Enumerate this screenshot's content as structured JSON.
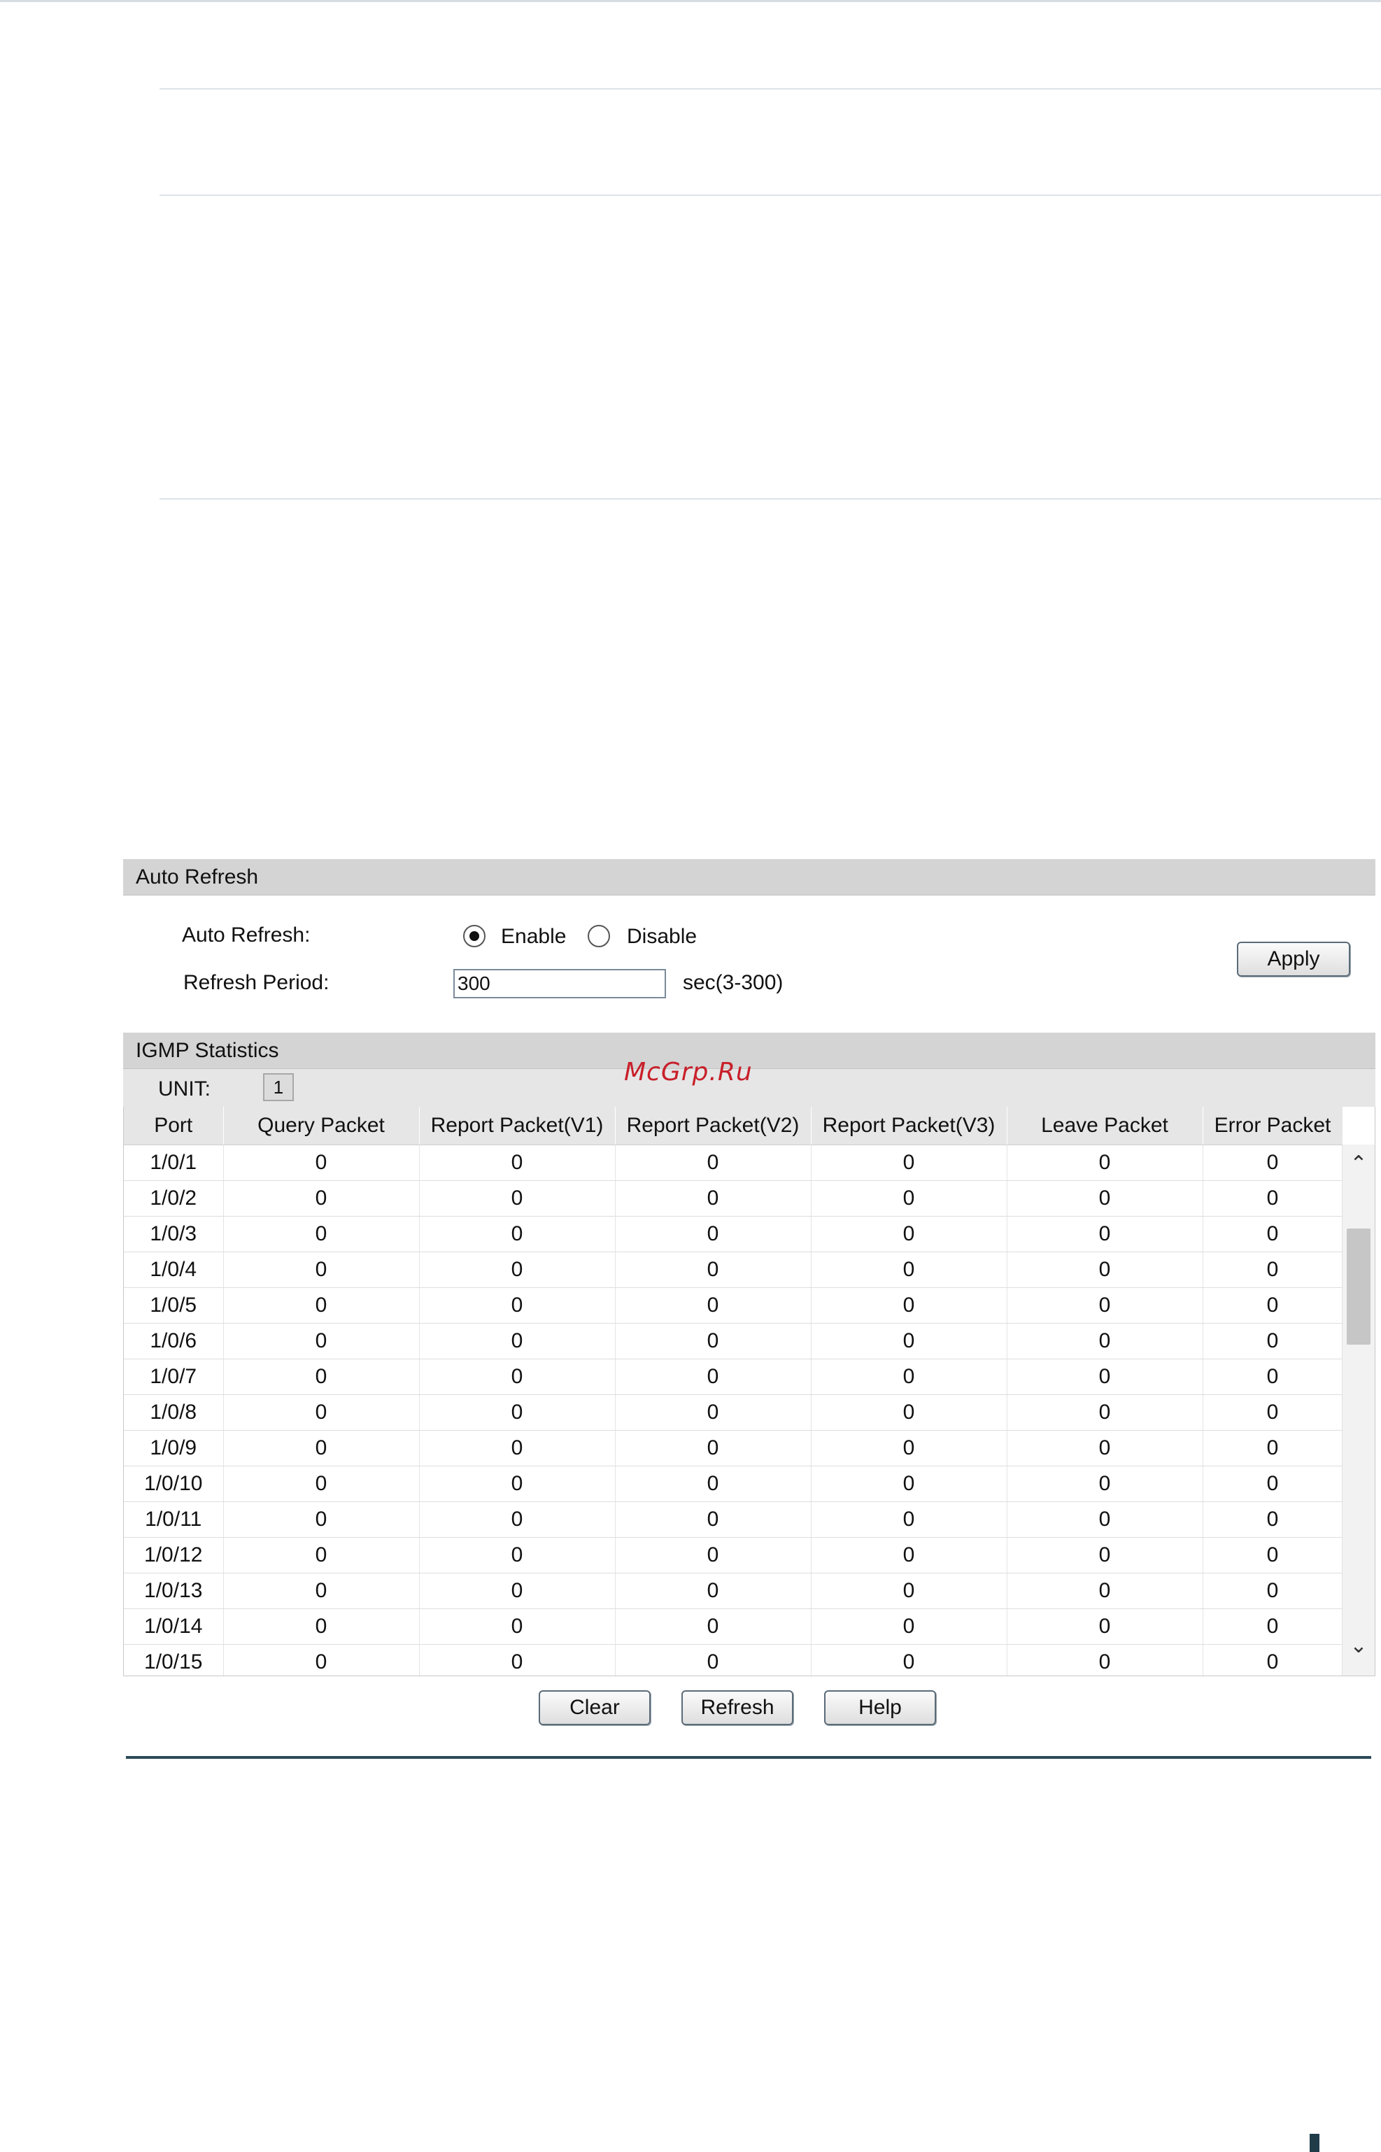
{
  "watermark": "McGrp.Ru",
  "auto_refresh": {
    "section_title": "Auto Refresh",
    "auto_refresh_label": "Auto Refresh:",
    "enable_label": "Enable",
    "disable_label": "Disable",
    "selected": "Enable",
    "refresh_period_label": "Refresh Period:",
    "refresh_period_value": "300",
    "refresh_period_hint": "sec(3-300)",
    "apply_label": "Apply"
  },
  "igmp_statistics": {
    "section_title": "IGMP Statistics",
    "unit_label": "UNIT:",
    "unit_value": "1",
    "columns": [
      "Port",
      "Query Packet",
      "Report Packet(V1)",
      "Report Packet(V2)",
      "Report Packet(V3)",
      "Leave Packet",
      "Error Packet"
    ],
    "rows": [
      [
        "1/0/1",
        "0",
        "0",
        "0",
        "0",
        "0",
        "0"
      ],
      [
        "1/0/2",
        "0",
        "0",
        "0",
        "0",
        "0",
        "0"
      ],
      [
        "1/0/3",
        "0",
        "0",
        "0",
        "0",
        "0",
        "0"
      ],
      [
        "1/0/4",
        "0",
        "0",
        "0",
        "0",
        "0",
        "0"
      ],
      [
        "1/0/5",
        "0",
        "0",
        "0",
        "0",
        "0",
        "0"
      ],
      [
        "1/0/6",
        "0",
        "0",
        "0",
        "0",
        "0",
        "0"
      ],
      [
        "1/0/7",
        "0",
        "0",
        "0",
        "0",
        "0",
        "0"
      ],
      [
        "1/0/8",
        "0",
        "0",
        "0",
        "0",
        "0",
        "0"
      ],
      [
        "1/0/9",
        "0",
        "0",
        "0",
        "0",
        "0",
        "0"
      ],
      [
        "1/0/10",
        "0",
        "0",
        "0",
        "0",
        "0",
        "0"
      ],
      [
        "1/0/11",
        "0",
        "0",
        "0",
        "0",
        "0",
        "0"
      ],
      [
        "1/0/12",
        "0",
        "0",
        "0",
        "0",
        "0",
        "0"
      ],
      [
        "1/0/13",
        "0",
        "0",
        "0",
        "0",
        "0",
        "0"
      ],
      [
        "1/0/14",
        "0",
        "0",
        "0",
        "0",
        "0",
        "0"
      ],
      [
        "1/0/15",
        "0",
        "0",
        "0",
        "0",
        "0",
        "0"
      ]
    ],
    "buttons": {
      "clear": "Clear",
      "refresh": "Refresh",
      "help": "Help"
    },
    "scroll": {
      "up_icon": "chevron-up-icon",
      "down_icon": "chevron-down-icon"
    }
  }
}
